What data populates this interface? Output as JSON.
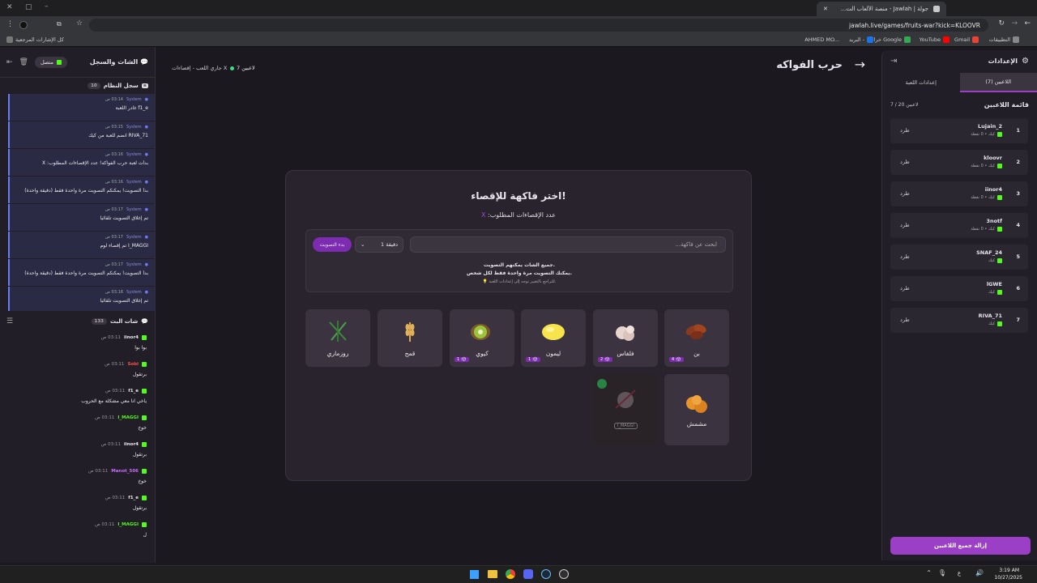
{
  "browser": {
    "tab_title": "جولة | Jawlah - منصة الألعاب الت...",
    "url": "jawlah.live/games/fruits-war?kick=KLOOVR",
    "bookmarks": [
      "التطبيقات",
      "Gmail",
      "YouTube",
      "خرائط Google",
      "البريد -",
      "AHMED MO...",
      "كل الإشارات المرجعية"
    ]
  },
  "left_panel": {
    "title": "الشات والسجل",
    "status": "متصل",
    "system_log": {
      "title": "سجل النظام",
      "count": "10",
      "items": [
        {
          "who": "System",
          "time": "03:14 ص",
          "msg": "f1_e غادر اللعبة"
        },
        {
          "who": "System",
          "time": "03:15 ص",
          "msg": "RIVA_71 انضم للعبة من كيك"
        },
        {
          "who": "System",
          "time": "03:16 ص",
          "msg": "بدأت لعبة حرب الفواكه! عدد الإقصاءات المطلوب: X"
        },
        {
          "who": "System",
          "time": "03:16 ص",
          "msg": "بدأ التصويت! يمكنكم التصويت مرة واحدة فقط (دقيقة واحدة)"
        },
        {
          "who": "System",
          "time": "03:17 ص",
          "msg": "تم إغلاق التصويت تلقائياً"
        },
        {
          "who": "System",
          "time": "03:17 ص",
          "msg": "I_MAGGI تم إقصاء لوم"
        },
        {
          "who": "System",
          "time": "03:17 ص",
          "msg": "بدأ التصويت! يمكنكم التصويت مرة واحدة فقط (دقيقة واحدة)"
        },
        {
          "who": "System",
          "time": "03:18 ص",
          "msg": "تم إغلاق التصويت تلقائياً"
        }
      ]
    },
    "live_chat": {
      "title": "شات البث",
      "count": "133",
      "items": [
        {
          "who": "iinor4",
          "time": "03:11 ص",
          "msg": "بوا بوا",
          "color": "#e8e8e8"
        },
        {
          "who": "Sobi",
          "time": "03:11 ص",
          "msg": "برتقول",
          "color": "#ff4d4d"
        },
        {
          "who": "f1_e",
          "time": "03:11 ص",
          "msg": "ياخي انا معي مشكلة مع الحروب",
          "color": "#e8e8e8"
        },
        {
          "who": "I_MAGGI",
          "time": "03:11 ص",
          "msg": "خوخ",
          "color": "#53fc18"
        },
        {
          "who": "iinor4",
          "time": "03:11 ص",
          "msg": "برتقول",
          "color": "#e8e8e8"
        },
        {
          "who": "Manot_506",
          "time": "03:11 ص",
          "msg": "خوخ",
          "color": "#c86bff"
        },
        {
          "who": "f1_e",
          "time": "03:11 ص",
          "msg": "برتقول",
          "color": "#e8e8e8"
        },
        {
          "who": "I_MAGGI",
          "time": "03:11 ص",
          "msg": "ل",
          "color": "#53fc18"
        }
      ]
    }
  },
  "game_header": {
    "title": "حرب الفواكه",
    "players": "7 لاعبين",
    "status": "جاري اللعب - إقصاءات X"
  },
  "modal": {
    "title": "اختر فاكهة للإقصاء!",
    "subtitle": "عدد الإقصاءات المطلوب:",
    "subtitle_value": "X",
    "search_placeholder": "ابحث عن فاكهة...",
    "duration": "1 دقيقة",
    "start_vote": "بدء التصويت",
    "info1": "جميع الشات يمكنهم التصويت.",
    "info2": "يمكنك التصويت مرة واحدة فقط لكل شخص.",
    "info3": "💡 للتراجع بالتغيير توجه إلى إعدادات اللعبة.",
    "fruits": [
      {
        "name": "بن",
        "votes": "4",
        "icon": "coffee-icon"
      },
      {
        "name": "فلفاس",
        "votes": "2",
        "icon": "garlic-icon"
      },
      {
        "name": "ليمون",
        "votes": "1",
        "icon": "lemon-icon"
      },
      {
        "name": "كيوي",
        "votes": "1",
        "icon": "kiwi-icon"
      },
      {
        "name": "قمح",
        "votes": "",
        "icon": "wheat-icon"
      },
      {
        "name": "روزماري",
        "votes": "",
        "icon": "rosemary-icon"
      },
      {
        "name": "مشمش",
        "votes": "",
        "icon": "apricot-icon"
      }
    ],
    "eliminated": {
      "owner": "I_MAGGI",
      "icon": "garlic-icon"
    }
  },
  "right_panel": {
    "title": "الإعدادات",
    "tab_players": "اللاعبين (7)",
    "tab_settings": "إعدادات اللعبة",
    "list_title": "قائمة اللاعبين",
    "list_count": "7 / 20 لاعبين",
    "kick_label": "طرد",
    "players": [
      {
        "n": "1",
        "name": "Lujain_2",
        "sub": "كيك • 0 نقطة"
      },
      {
        "n": "2",
        "name": "kloovr",
        "sub": "كيك • 0 نقطة"
      },
      {
        "n": "3",
        "name": "iinor4",
        "sub": "كيك • 0 نقطة"
      },
      {
        "n": "4",
        "name": "3notf",
        "sub": "كيك • 0 نقطة"
      },
      {
        "n": "5",
        "name": "SNAF_24",
        "sub": "كيك"
      },
      {
        "n": "6",
        "name": "lGWE",
        "sub": "كيك"
      },
      {
        "n": "7",
        "name": "RIVA_71",
        "sub": "كيك"
      }
    ],
    "clear_button": "إزالة جميع اللاعبين"
  },
  "taskbar": {
    "time": "3:19 AM",
    "date": "10/27/2025",
    "lang": "ع"
  }
}
